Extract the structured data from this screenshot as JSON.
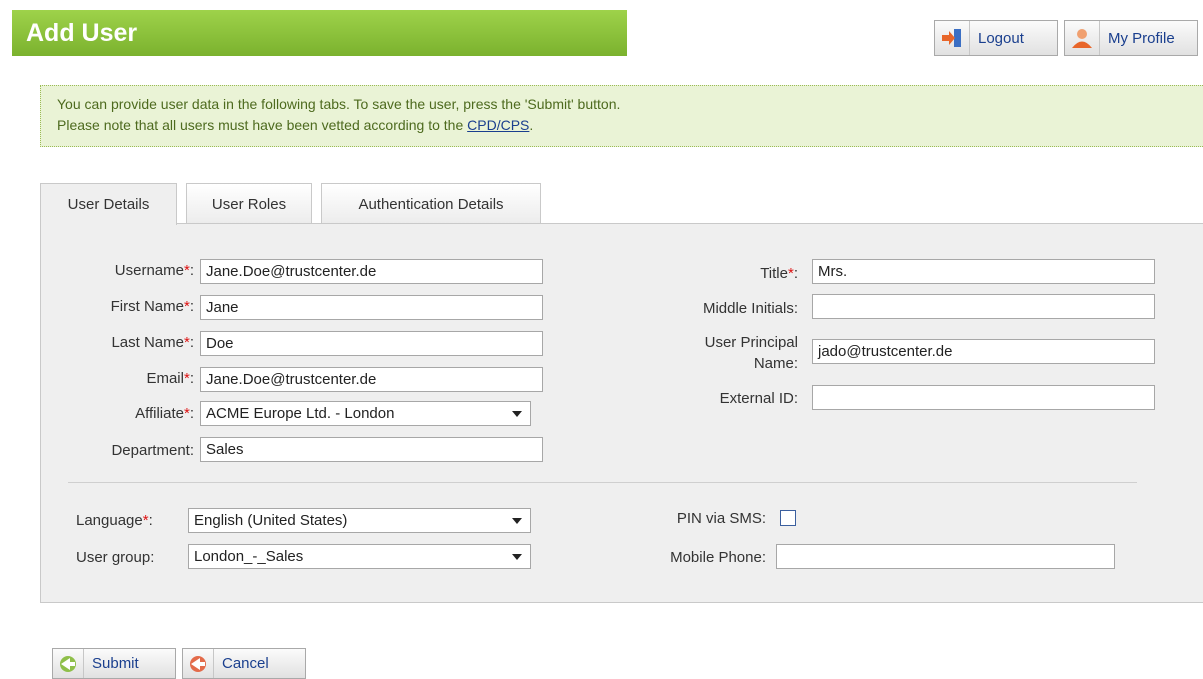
{
  "header": {
    "title": "Add User",
    "logout_label": "Logout",
    "profile_label": "My Profile"
  },
  "info": {
    "line1": "You can provide user data in the following tabs. To save the user, press the 'Submit' button.",
    "line2_prefix": "Please note that all users must have been vetted according to the ",
    "link": "CPD/CPS",
    "line2_suffix": "."
  },
  "tabs": [
    {
      "label": "User Details"
    },
    {
      "label": "User Roles"
    },
    {
      "label": "Authentication Details"
    }
  ],
  "required_mark": "*",
  "form": {
    "username": {
      "label": "Username",
      "value": "Jane.Doe@trustcenter.de"
    },
    "first_name": {
      "label": "First Name",
      "value": "Jane"
    },
    "last_name": {
      "label": "Last Name",
      "value": "Doe"
    },
    "email": {
      "label": "Email",
      "value": "Jane.Doe@trustcenter.de"
    },
    "affiliate": {
      "label": "Affiliate",
      "value": "ACME Europe Ltd. - London"
    },
    "department": {
      "label": "Department:",
      "value": "Sales"
    },
    "title": {
      "label": "Title",
      "value": "Mrs."
    },
    "middle_initials": {
      "label": "Middle Initials:",
      "value": ""
    },
    "upn": {
      "label_line1": "User Principal",
      "label_line2": "Name:",
      "value": "jado@trustcenter.de"
    },
    "external_id": {
      "label": "External ID:",
      "value": ""
    },
    "language": {
      "label": "Language",
      "value": "English (United States)"
    },
    "user_group": {
      "label": "User group:",
      "value": "London_-_Sales"
    },
    "pin_sms": {
      "label": "PIN via SMS:",
      "checked": false
    },
    "mobile_phone": {
      "label": "Mobile Phone:",
      "value": ""
    }
  },
  "footer": {
    "submit_label": "Submit",
    "cancel_label": "Cancel"
  },
  "colors": {
    "accent_green": "#8cc63f",
    "info_bg": "#eaf3d6",
    "link_blue": "#1a3f8e",
    "required_red": "#dd1111"
  }
}
